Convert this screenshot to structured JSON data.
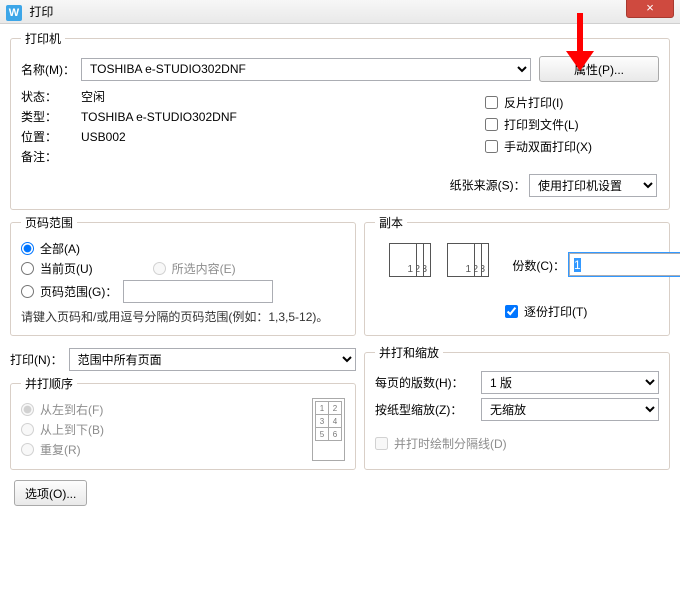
{
  "title": "打印",
  "close_x": "×",
  "printer": {
    "legend": "打印机",
    "name_label": "名称(M)：",
    "name_value": "TOSHIBA e-STUDIO302DNF",
    "properties_btn": "属性(P)...",
    "status_label": "状态：",
    "status_value": "空闲",
    "type_label": "类型：",
    "type_value": "TOSHIBA e-STUDIO302DNF",
    "where_label": "位置：",
    "where_value": "USB002",
    "comment_label": "备注：",
    "comment_value": "",
    "opt_reverse": "反片打印(I)",
    "opt_tofile": "打印到文件(L)",
    "opt_duplex": "手动双面打印(X)",
    "paper_src_label": "纸张来源(S)：",
    "paper_src_value": "使用打印机设置"
  },
  "range": {
    "legend": "页码范围",
    "all": "全部(A)",
    "current": "当前页(U)",
    "selection": "所选内容(E)",
    "pages": "页码范围(G)：",
    "pages_value": "",
    "hint": "请键入页码和/或用逗号分隔的页码范围(例如：1,3,5-12)。"
  },
  "copies": {
    "legend": "副本",
    "count_label": "份数(C)：",
    "count_value": "1",
    "collate": "逐份打印(T)"
  },
  "printwhat": {
    "label": "打印(N)：",
    "value": "范围中所有页面"
  },
  "order": {
    "legend": "并打顺序",
    "lr": "从左到右(F)",
    "tb": "从上到下(B)",
    "rep": "重复(R)"
  },
  "scale": {
    "legend": "并打和缩放",
    "per_page_label": "每页的版数(H)：",
    "per_page_value": "1 版",
    "scale_label": "按纸型缩放(Z)：",
    "scale_value": "无缩放",
    "draw_lines": "并打时绘制分隔线(D)"
  },
  "options_btn": "选项(O)..."
}
